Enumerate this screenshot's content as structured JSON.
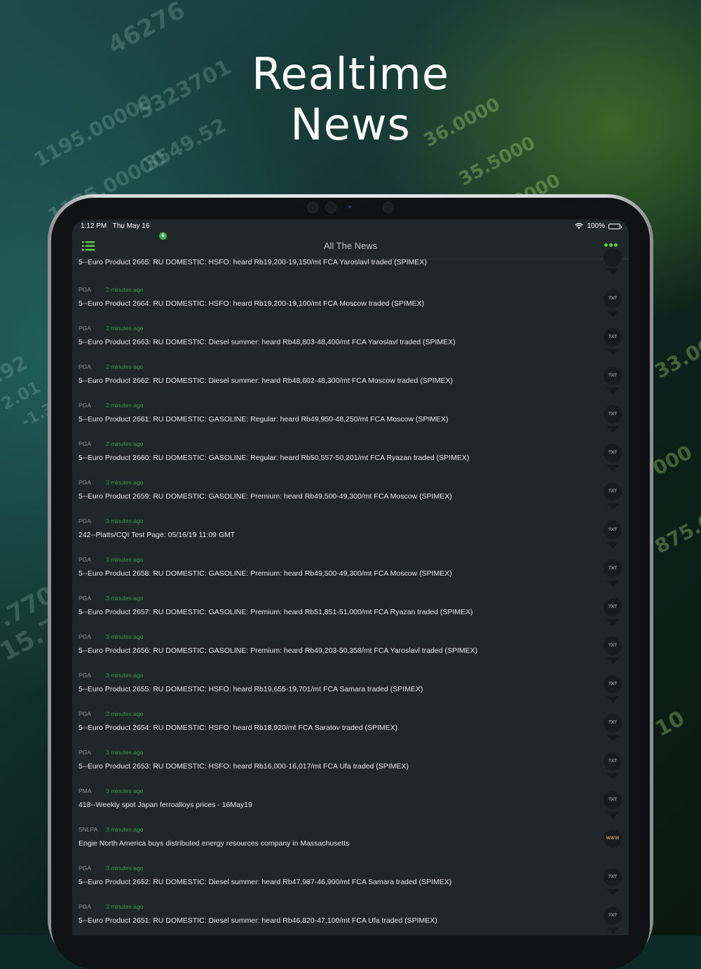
{
  "promo": {
    "headline_line1": "Realtime",
    "headline_line2": "News"
  },
  "background_numbers": [
    "46276",
    "5323701",
    "3549.52",
    "1195.00000",
    "1135.00000",
    "36.0000",
    "35.5000",
    ".0000",
    "33.000",
    "000",
    "875.00",
    "10",
    ".7700",
    "15.750",
    "2.01",
    ".92",
    "-1.3"
  ],
  "status_bar": {
    "time": "1:12 PM",
    "date": "Thu May 16",
    "battery": "100%"
  },
  "nav": {
    "title": "All The News",
    "badge_count": "6"
  },
  "first_item": {
    "headline": "5--Euro Product 2665: RU DOMESTIC: HSFO: heard Rb19,200-19,150/mt FCA Yaroslavl traded (SPIMEX)"
  },
  "news_items": [
    {
      "source": "PGA",
      "time": "2 minutes ago",
      "headline": "5--Euro Product 2664: RU DOMESTIC: HSFO: heard Rb19,200-19,100/mt FCA Moscow traded (SPIMEX)",
      "type": "TXT"
    },
    {
      "source": "PGA",
      "time": "2 minutes ago",
      "headline": "5--Euro Product 2663: RU DOMESTIC: Diesel summer: heard Rb48,803-48,400/mt FCA Yaroslavl traded (SPIMEX)",
      "type": "TXT"
    },
    {
      "source": "PGA",
      "time": "2 minutes ago",
      "headline": "5--Euro Product 2662: RU DOMESTIC: Diesel summer: heard Rb48,602-48,300/mt FCA Moscow traded (SPIMEX)",
      "type": "TXT"
    },
    {
      "source": "PGA",
      "time": "2 minutes ago",
      "headline": "5--Euro Product 2661: RU DOMESTIC: GASOLINE: Regular: heard Rb49,950-48,250/mt FCA Moscow  (SPIMEX)",
      "type": "TXT"
    },
    {
      "source": "PGA",
      "time": "2 minutes ago",
      "headline": "5--Euro Product 2660: RU DOMESTIC: GASOLINE: Regular: heard Rb50,557-50,201/mt FCA Ryazan traded (SPIMEX)",
      "type": "TXT"
    },
    {
      "source": "PGA",
      "time": "3 minutes ago",
      "headline": "5--Euro Product 2659: RU DOMESTIC: GASOLINE: Premium: heard Rb49,500-49,300/mt FCA Moscow  (SPIMEX)",
      "type": "TXT"
    },
    {
      "source": "PGA",
      "time": "3 minutes ago",
      "headline": "242--Platts/CQI Test Page: 05/16/19 11:09 GMT",
      "type": "TXT"
    },
    {
      "source": "PGA",
      "time": "3 minutes ago",
      "headline": "5--Euro Product 2658: RU DOMESTIC: GASOLINE: Premium: heard Rb49,500-49,300/mt FCA Moscow  (SPIMEX)",
      "type": "TXT"
    },
    {
      "source": "PGA",
      "time": "3 minutes ago",
      "headline": "5--Euro Product 2657: RU DOMESTIC: GASOLINE: Premium: heard Rb51,851-51,000/mt FCA Ryazan traded (SPIMEX)",
      "type": "TXT"
    },
    {
      "source": "PGA",
      "time": "3 minutes ago",
      "headline": "5--Euro Product 2656: RU DOMESTIC: GASOLINE: Premium: heard Rb49,203-50,358/mt FCA Yaroslavl traded (SPIMEX)",
      "type": "TXT"
    },
    {
      "source": "PGA",
      "time": "3 minutes ago",
      "headline": "5--Euro Product 2655: RU DOMESTIC: HSFO: heard Rb19,655-19,701/mt FCA Samara traded (SPIMEX)",
      "type": "TXT"
    },
    {
      "source": "PGA",
      "time": "3 minutes ago",
      "headline": "5--Euro Product 2654: RU DOMESTIC: HSFO: heard Rb18,920/mt FCA Saratov traded (SPIMEX)",
      "type": "TXT"
    },
    {
      "source": "PGA",
      "time": "3 minutes ago",
      "headline": "5--Euro Product 2653: RU DOMESTIC: HSFO: heard Rb16,000-16,017/mt FCA Ufa traded (SPIMEX)",
      "type": "TXT"
    },
    {
      "source": "PMA",
      "time": "3 minutes ago",
      "headline": "418--Weekly spot Japan ferroalloys prices - 16May19",
      "type": "TXT"
    },
    {
      "source": "SNLPA",
      "time": "3 minutes ago",
      "headline": "Engie North America buys distributed energy resources company in Massachusetts",
      "type": "WWW"
    },
    {
      "source": "PGA",
      "time": "3 minutes ago",
      "headline": "5--Euro Product 2652: RU DOMESTIC: Diesel summer:  heard Rb47,987-46,900/mt FCA Samara traded (SPIMEX)",
      "type": "TXT"
    },
    {
      "source": "PGA",
      "time": "3 minutes ago",
      "headline": "5--Euro Product 2651: RU DOMESTIC: Diesel summer:  heard Rb46,820-47,100/mt FCA Ufa  traded (SPIMEX)",
      "type": "TXT"
    }
  ],
  "colors": {
    "accent_green": "#5fcf3c",
    "time_green": "#3b9a4a",
    "screen_bg": "#1f2729",
    "badge_green": "#3fa94b"
  }
}
